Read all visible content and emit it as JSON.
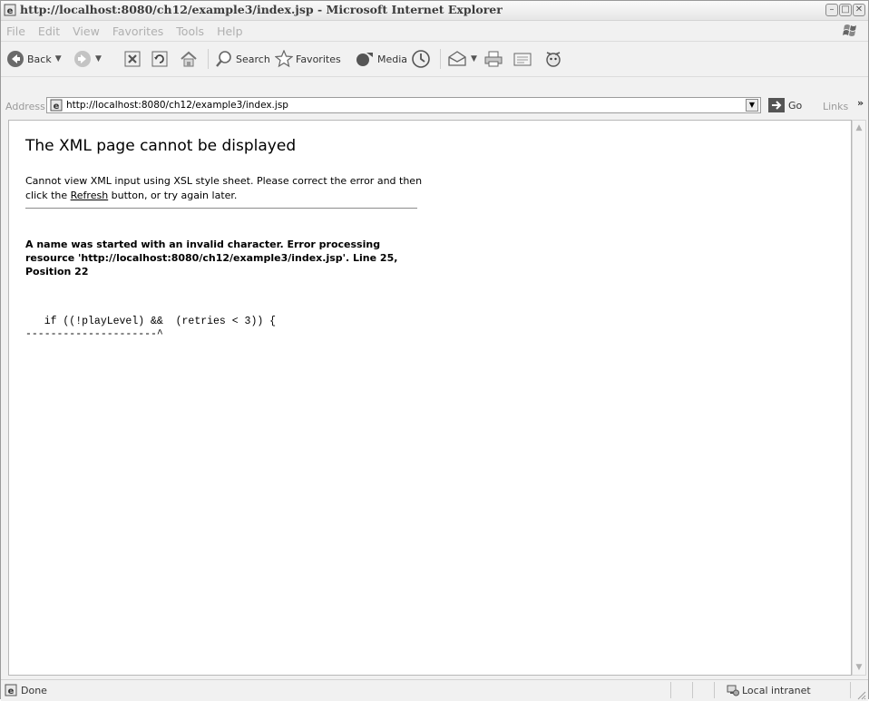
{
  "window": {
    "title": "http://localhost:8080/ch12/example3/index.jsp - Microsoft Internet Explorer",
    "controls": {
      "minimize": "–",
      "maximize": "□",
      "close": "✕"
    }
  },
  "menu": {
    "items": [
      "File",
      "Edit",
      "View",
      "Favorites",
      "Tools",
      "Help"
    ]
  },
  "toolbar": {
    "back_label": "Back",
    "search_label": "Search",
    "favorites_label": "Favorites",
    "media_label": "Media"
  },
  "address": {
    "label": "Address",
    "url": "http://localhost:8080/ch12/example3/index.jsp",
    "go_label": "Go",
    "links_label": "Links",
    "links_chevron": "»"
  },
  "page": {
    "title": "The XML page cannot be displayed",
    "desc_part1": "Cannot view XML input using XSL style sheet. Please correct the error and then click the ",
    "refresh_link": "Refresh",
    "desc_part2": " button, or try again later.",
    "error_message": "A name was started with an invalid character. Error processing resource 'http://localhost:8080/ch12/example3/index.jsp'. Line 25, Position 22",
    "code_line": "   if ((!playLevel) &&  (retries < 3)) {",
    "code_pointer": "---------------------^"
  },
  "status": {
    "text": "Done",
    "zone": "Local intranet"
  },
  "icons": {
    "page": "ie-page-icon",
    "back": "back-arrow-icon",
    "forward": "forward-arrow-icon",
    "stop": "stop-icon",
    "refresh": "refresh-icon",
    "home": "home-icon",
    "search": "search-icon",
    "favorites": "favorites-star-icon",
    "media": "media-icon",
    "history": "history-icon",
    "mail": "mail-icon",
    "print": "print-icon",
    "edit": "edit-icon",
    "messenger": "messenger-icon",
    "go": "go-arrow-icon",
    "zone": "local-intranet-icon"
  }
}
